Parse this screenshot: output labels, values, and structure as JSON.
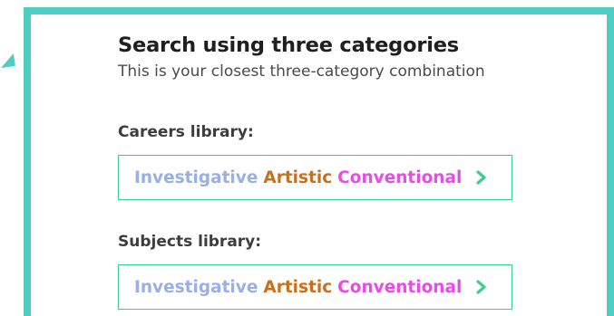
{
  "panel": {
    "title": "Search using three categories",
    "subtitle": "This is your closest three-category combination",
    "border_color": "#4ecdc4"
  },
  "careers": {
    "label": "Careers library:",
    "categories": [
      {
        "name": "Investigative",
        "color": "#9aaee8"
      },
      {
        "name": "Artistic",
        "color": "#c8701e"
      },
      {
        "name": "Conventional",
        "color": "#e84ce8"
      }
    ],
    "chevron_icon": "chevron-right-icon",
    "chevron_color": "#3bcf8e"
  },
  "subjects": {
    "label": "Subjects library:",
    "categories": [
      {
        "name": "Investigative",
        "color": "#9aaee8"
      },
      {
        "name": "Artistic",
        "color": "#c8701e"
      },
      {
        "name": "Conventional",
        "color": "#e84ce8"
      }
    ],
    "chevron_icon": "chevron-right-icon",
    "chevron_color": "#3bcf8e"
  }
}
